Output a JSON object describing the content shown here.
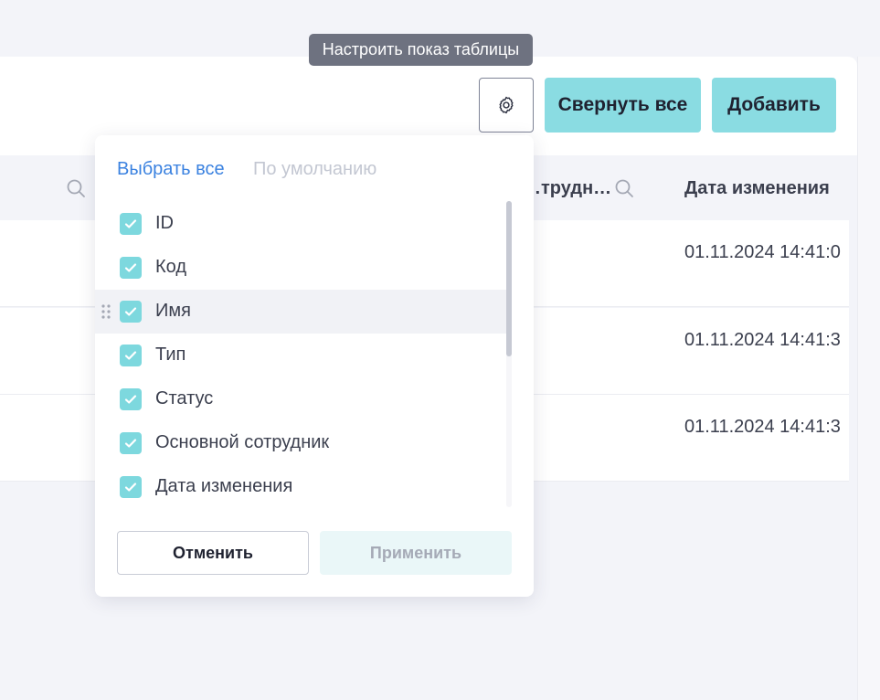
{
  "tooltip": {
    "text": "Настроить показ таблицы"
  },
  "toolbar": {
    "settings_icon": "gear-icon",
    "collapse_all_label": "Свернуть все",
    "add_label": "Добавить"
  },
  "table": {
    "headers": [
      "…трудн…",
      "Дата изменения"
    ],
    "rows": [
      {
        "modified": "01.11.2024 14:41:0"
      },
      {
        "modified": "01.11.2024 14:41:3"
      },
      {
        "modified": "01.11.2024 14:41:3"
      }
    ]
  },
  "column_settings": {
    "select_all_label": "Выбрать все",
    "default_label": "По умолчанию",
    "columns": [
      {
        "label": "ID",
        "checked": true
      },
      {
        "label": "Код",
        "checked": true
      },
      {
        "label": "Имя",
        "checked": true
      },
      {
        "label": "Тип",
        "checked": true
      },
      {
        "label": "Статус",
        "checked": true
      },
      {
        "label": "Основной сотрудник",
        "checked": true
      },
      {
        "label": "Дата изменения",
        "checked": true
      }
    ],
    "cancel_label": "Отменить",
    "apply_label": "Применить"
  },
  "colors": {
    "accent": "#8adce2",
    "checkbox": "#7dd8de",
    "link": "#3b82e0",
    "link_muted": "#c3c7d2"
  }
}
